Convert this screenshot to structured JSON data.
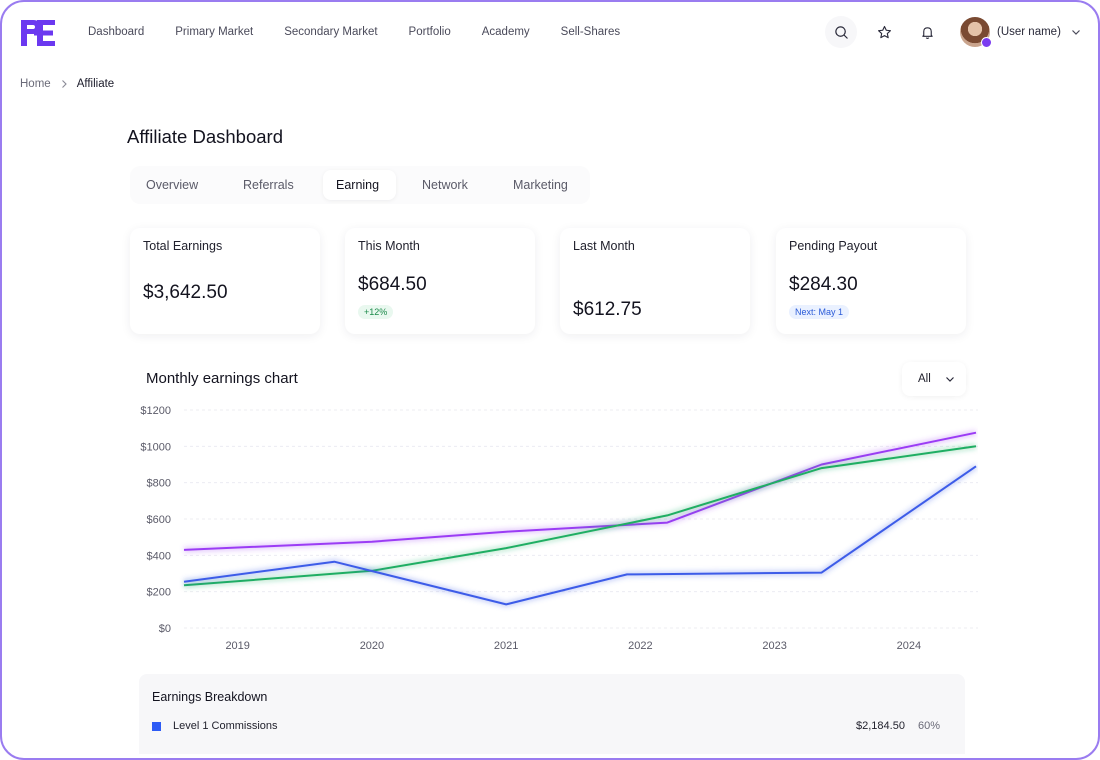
{
  "brand": {
    "logo_text": "PE",
    "logo_color": "#6b38f0"
  },
  "nav": {
    "items": [
      "Dashboard",
      "Primary Market",
      "Secondary Market",
      "Portfolio",
      "Academy",
      "Sell-Shares"
    ]
  },
  "header": {
    "icons": [
      "search-icon",
      "star-icon",
      "bell-icon"
    ],
    "user_name": "(User name)"
  },
  "breadcrumb": {
    "home": "Home",
    "current": "Affiliate"
  },
  "page_title": "Affiliate Dashboard",
  "tabs": {
    "items": [
      "Overview",
      "Referrals",
      "Earning",
      "Network",
      "Marketing"
    ],
    "active": "Earning"
  },
  "stats": [
    {
      "label": "Total Earnings",
      "value": "$3,642.50",
      "pill": ""
    },
    {
      "label": "This Month",
      "value": "$684.50",
      "pill": "+12%"
    },
    {
      "label": "Last Month",
      "value": "$612.75",
      "pill": ""
    },
    {
      "label": "Pending Payout",
      "value": "$284.30",
      "pill": "Next: May 1"
    }
  ],
  "chart": {
    "title": "Monthly earnings chart",
    "filter": "All"
  },
  "chart_data": {
    "type": "line",
    "x": [
      "2019",
      "2020",
      "2021",
      "2022",
      "2023",
      "2024"
    ],
    "yticks": [
      "$0",
      "$200",
      "$400",
      "$600",
      "$800",
      "$1000",
      "$1200"
    ],
    "ylim": [
      0,
      1200
    ],
    "grid": true,
    "series": [
      {
        "color": "#9b3cf5",
        "points": [
          [
            2018.6,
            430
          ],
          [
            2020,
            475
          ],
          [
            2021,
            530
          ],
          [
            2022.2,
            580
          ],
          [
            2023.35,
            900
          ],
          [
            2024.5,
            1075
          ]
        ]
      },
      {
        "color": "#1fae63",
        "points": [
          [
            2018.6,
            235
          ],
          [
            2020,
            315
          ],
          [
            2021,
            440
          ],
          [
            2022.2,
            620
          ],
          [
            2023.35,
            880
          ],
          [
            2024.5,
            1000
          ]
        ]
      },
      {
        "color": "#3d5ce8",
        "points": [
          [
            2018.6,
            255
          ],
          [
            2019.72,
            365
          ],
          [
            2021,
            130
          ],
          [
            2021.9,
            295
          ],
          [
            2023.35,
            305
          ],
          [
            2024.5,
            890
          ]
        ]
      }
    ]
  },
  "breakdown": {
    "title": "Earnings Breakdown",
    "rows": [
      {
        "label": "Level 1 Commissions",
        "amount": "$2,184.50",
        "pct": "60%",
        "color": "#2d5bf5"
      }
    ]
  }
}
